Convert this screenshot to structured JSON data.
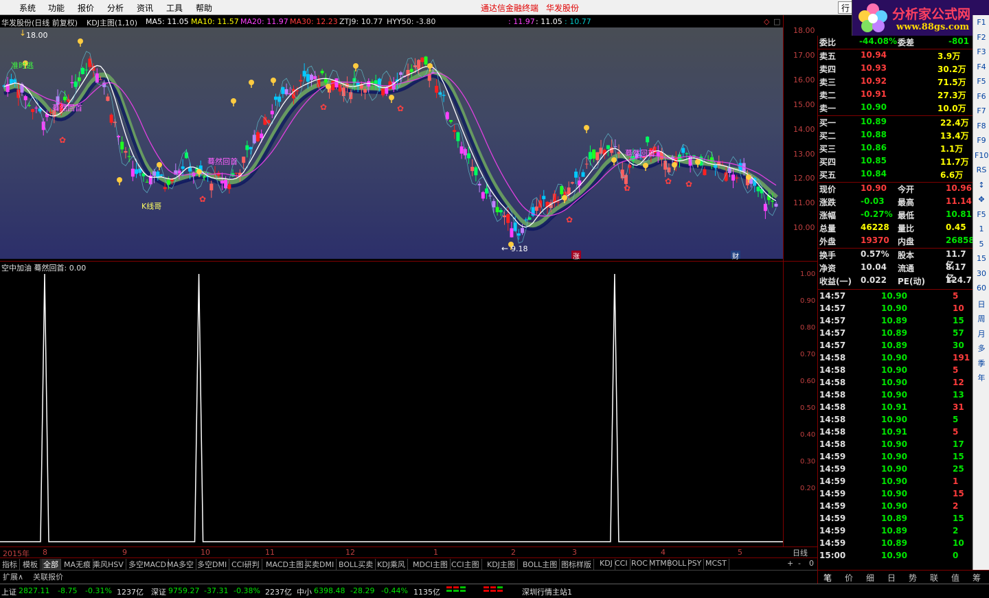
{
  "menu": {
    "items": [
      "系统",
      "功能",
      "报价",
      "分析",
      "资讯",
      "工具",
      "帮助"
    ],
    "center_title": "通达信金融终端",
    "stock_title": "华发股份",
    "trade_btn": "行"
  },
  "logo": {
    "title": "分析家公式网",
    "url": "www.88gs.com"
  },
  "main_info": {
    "stock": "华发股份(日线 前复权)",
    "indicator": "KDJ主图(1,10)",
    "ma5": "MA5: 11.05",
    "ma10": "MA10: 11.57",
    "ma20": "MA20: 11.97",
    "ma30": "MA30: 12.23",
    "ztj9": "ZTJ9: 10.77",
    "hyy50": "HYY50: -3.80",
    "v1": ": 11.97",
    "v2": ": 11.05",
    "v3": ": 10.77"
  },
  "main_chart": {
    "high_label": "18.00",
    "low_label": "9.18",
    "annot_escape": "准时逃",
    "annot_kline": "K线哥",
    "annot_back1": "蓦然回首",
    "annot_back2": "蓦然回首",
    "annot_back3": "蓦然回首",
    "mark_zhang": "涨",
    "mark_cai": "财"
  },
  "chart_data": {
    "type": "candlestick",
    "y_ticks": [
      "18.00",
      "17.00",
      "16.00",
      "15.00",
      "14.00",
      "13.00",
      "12.00",
      "11.00",
      "10.00"
    ],
    "ylim": [
      9.0,
      18.2
    ],
    "high": 18.0,
    "low": 9.18,
    "close_trend": [
      15.9,
      16.2,
      15.4,
      14.8,
      14.5,
      14.9,
      15.6,
      16.3,
      17.1,
      16.4,
      14.9,
      13.2,
      12.4,
      11.8,
      12.2,
      11.7,
      12.3,
      12.6,
      12.1,
      11.9,
      12.0,
      11.8,
      12.4,
      13.3,
      14.1,
      14.9,
      15.6,
      15.9,
      16.1,
      16.3,
      16.2,
      16.0,
      15.8,
      16.1,
      16.0,
      15.7,
      16.2,
      16.4,
      16.6,
      16.9,
      16.5,
      15.3,
      14.1,
      13.0,
      12.0,
      11.2,
      10.7,
      10.2,
      9.6,
      10.3,
      10.8,
      11.0,
      11.2,
      11.6,
      12.2,
      12.8,
      13.4,
      13.1,
      12.3,
      12.7,
      13.3,
      13.0,
      12.6,
      12.8,
      12.9,
      12.5,
      12.6,
      12.4,
      12.3,
      12.1,
      11.5,
      11.0,
      10.9
    ]
  },
  "sub_chart": {
    "title": "空中加油 蓦然回首: 0.00",
    "y_ticks": [
      "1.00",
      "0.90",
      "0.80",
      "0.70",
      "0.60",
      "0.50",
      "0.40",
      "0.30",
      "0.20"
    ],
    "spikes_at": [
      0.057,
      0.254,
      0.785
    ]
  },
  "date_axis": {
    "labels": [
      "2015年",
      "8",
      "9",
      "10",
      "11",
      "12",
      "1",
      "2",
      "3",
      "4",
      "5"
    ],
    "period": "日线"
  },
  "tabs": [
    "指标",
    "模板",
    "全部",
    "MA无痕",
    "乘风HSV",
    "多空MACD",
    "MA多空",
    "多空DMI",
    "CCI研判",
    "MACD主图",
    "买卖DMI",
    "BOLL买卖",
    "KDJ乘风",
    "MDCI主图",
    "CCI主图",
    "KDJ主图",
    "BOLL主图",
    "图标样版",
    "KDJ",
    "CCI",
    "ROC",
    "MTM",
    "BOLL",
    "PSY",
    "MCST"
  ],
  "tab_ctrl": [
    "+",
    "-",
    "0"
  ],
  "tab2": [
    "扩展∧",
    "关联报价"
  ],
  "quote": {
    "weibi": {
      "label": "委比",
      "value": "-44.08%",
      "label2": "委差",
      "value2": "-801"
    },
    "sell": [
      {
        "label": "卖五",
        "price": "10.94",
        "vol": "3.9万"
      },
      {
        "label": "卖四",
        "price": "10.93",
        "vol": "30.2万"
      },
      {
        "label": "卖三",
        "price": "10.92",
        "vol": "71.5万"
      },
      {
        "label": "卖二",
        "price": "10.91",
        "vol": "27.3万"
      },
      {
        "label": "卖一",
        "price": "10.90",
        "vol": "10.0万"
      }
    ],
    "buy": [
      {
        "label": "买一",
        "price": "10.89",
        "vol": "22.4万"
      },
      {
        "label": "买二",
        "price": "10.88",
        "vol": "13.4万"
      },
      {
        "label": "买三",
        "price": "10.86",
        "vol": "1.1万"
      },
      {
        "label": "买四",
        "price": "10.85",
        "vol": "11.7万"
      },
      {
        "label": "买五",
        "price": "10.84",
        "vol": "6.6万"
      }
    ],
    "stats": [
      {
        "l1": "现价",
        "v1": "10.90",
        "l2": "今开",
        "v2": "10.96"
      },
      {
        "l1": "涨跌",
        "v1": "-0.03",
        "l2": "最高",
        "v2": "11.14"
      },
      {
        "l1": "涨幅",
        "v1": "-0.27%",
        "l2": "最低",
        "v2": "10.81"
      },
      {
        "l1": "总量",
        "v1": "46228",
        "l2": "量比",
        "v2": "0.45"
      },
      {
        "l1": "外盘",
        "v1": "19370",
        "l2": "内盘",
        "v2": "26858"
      }
    ],
    "stats2": [
      {
        "l1": "换手",
        "v1": "0.57%",
        "l2": "股本",
        "v2": "11.7亿"
      },
      {
        "l1": "净资",
        "v1": "10.04",
        "l2": "流通",
        "v2": "8.17亿"
      },
      {
        "l1": "收益(一)",
        "v1": "0.022",
        "l2": "PE(动)",
        "v2": "124.7"
      }
    ]
  },
  "ticks": [
    {
      "t": "14:57",
      "p": "10.90",
      "v": "5",
      "c": "up"
    },
    {
      "t": "14:57",
      "p": "10.90",
      "v": "10",
      "c": "up"
    },
    {
      "t": "14:57",
      "p": "10.89",
      "v": "15",
      "c": "dn"
    },
    {
      "t": "14:57",
      "p": "10.89",
      "v": "57",
      "c": "dn"
    },
    {
      "t": "14:57",
      "p": "10.89",
      "v": "30",
      "c": "dn"
    },
    {
      "t": "14:58",
      "p": "10.90",
      "v": "191",
      "c": "up"
    },
    {
      "t": "14:58",
      "p": "10.90",
      "v": "5",
      "c": "up"
    },
    {
      "t": "14:58",
      "p": "10.90",
      "v": "12",
      "c": "up"
    },
    {
      "t": "14:58",
      "p": "10.90",
      "v": "13",
      "c": "dn"
    },
    {
      "t": "14:58",
      "p": "10.91",
      "v": "31",
      "c": "up"
    },
    {
      "t": "14:58",
      "p": "10.90",
      "v": "5",
      "c": "dn"
    },
    {
      "t": "14:58",
      "p": "10.91",
      "v": "5",
      "c": "up"
    },
    {
      "t": "14:58",
      "p": "10.90",
      "v": "17",
      "c": "dn"
    },
    {
      "t": "14:59",
      "p": "10.90",
      "v": "15",
      "c": "dn"
    },
    {
      "t": "14:59",
      "p": "10.90",
      "v": "25",
      "c": "dn"
    },
    {
      "t": "14:59",
      "p": "10.90",
      "v": "1",
      "c": "up"
    },
    {
      "t": "14:59",
      "p": "10.90",
      "v": "15",
      "c": "up"
    },
    {
      "t": "14:59",
      "p": "10.90",
      "v": "2",
      "c": "up"
    },
    {
      "t": "14:59",
      "p": "10.89",
      "v": "15",
      "c": "dn"
    },
    {
      "t": "14:59",
      "p": "10.89",
      "v": "2",
      "c": "dn"
    },
    {
      "t": "14:59",
      "p": "10.89",
      "v": "10",
      "c": "dn"
    },
    {
      "t": "15:00",
      "p": "10.90",
      "v": "0",
      "c": "dn"
    }
  ],
  "sidebar": [
    "F1",
    "F2",
    "F3",
    "F4",
    "F5",
    "F6",
    "F7",
    "F8",
    "F9",
    "F10",
    "RS",
    "↕",
    "✥",
    "F5",
    "1",
    "5",
    "15",
    "30",
    "60",
    "日",
    "周",
    "月",
    "多",
    "季",
    "年"
  ],
  "rtabs": [
    "笔",
    "价",
    "细",
    "日",
    "势",
    "联",
    "值",
    "筹"
  ],
  "status": {
    "sh_label": "上证",
    "sh_val": "2827.11",
    "sh_chg": "-8.75",
    "sh_pct": "-0.31%",
    "sh_amt": "1237亿",
    "sz_label": "深证",
    "sz_val": "9759.27",
    "sz_chg": "-37.31",
    "sz_pct": "-0.38%",
    "sz_amt": "2237亿",
    "zx_label": "中小",
    "zx_val": "6398.48",
    "zx_chg": "-28.29",
    "zx_pct": "-0.44%",
    "zx_amt": "1135亿",
    "server": "深圳行情主站1"
  }
}
